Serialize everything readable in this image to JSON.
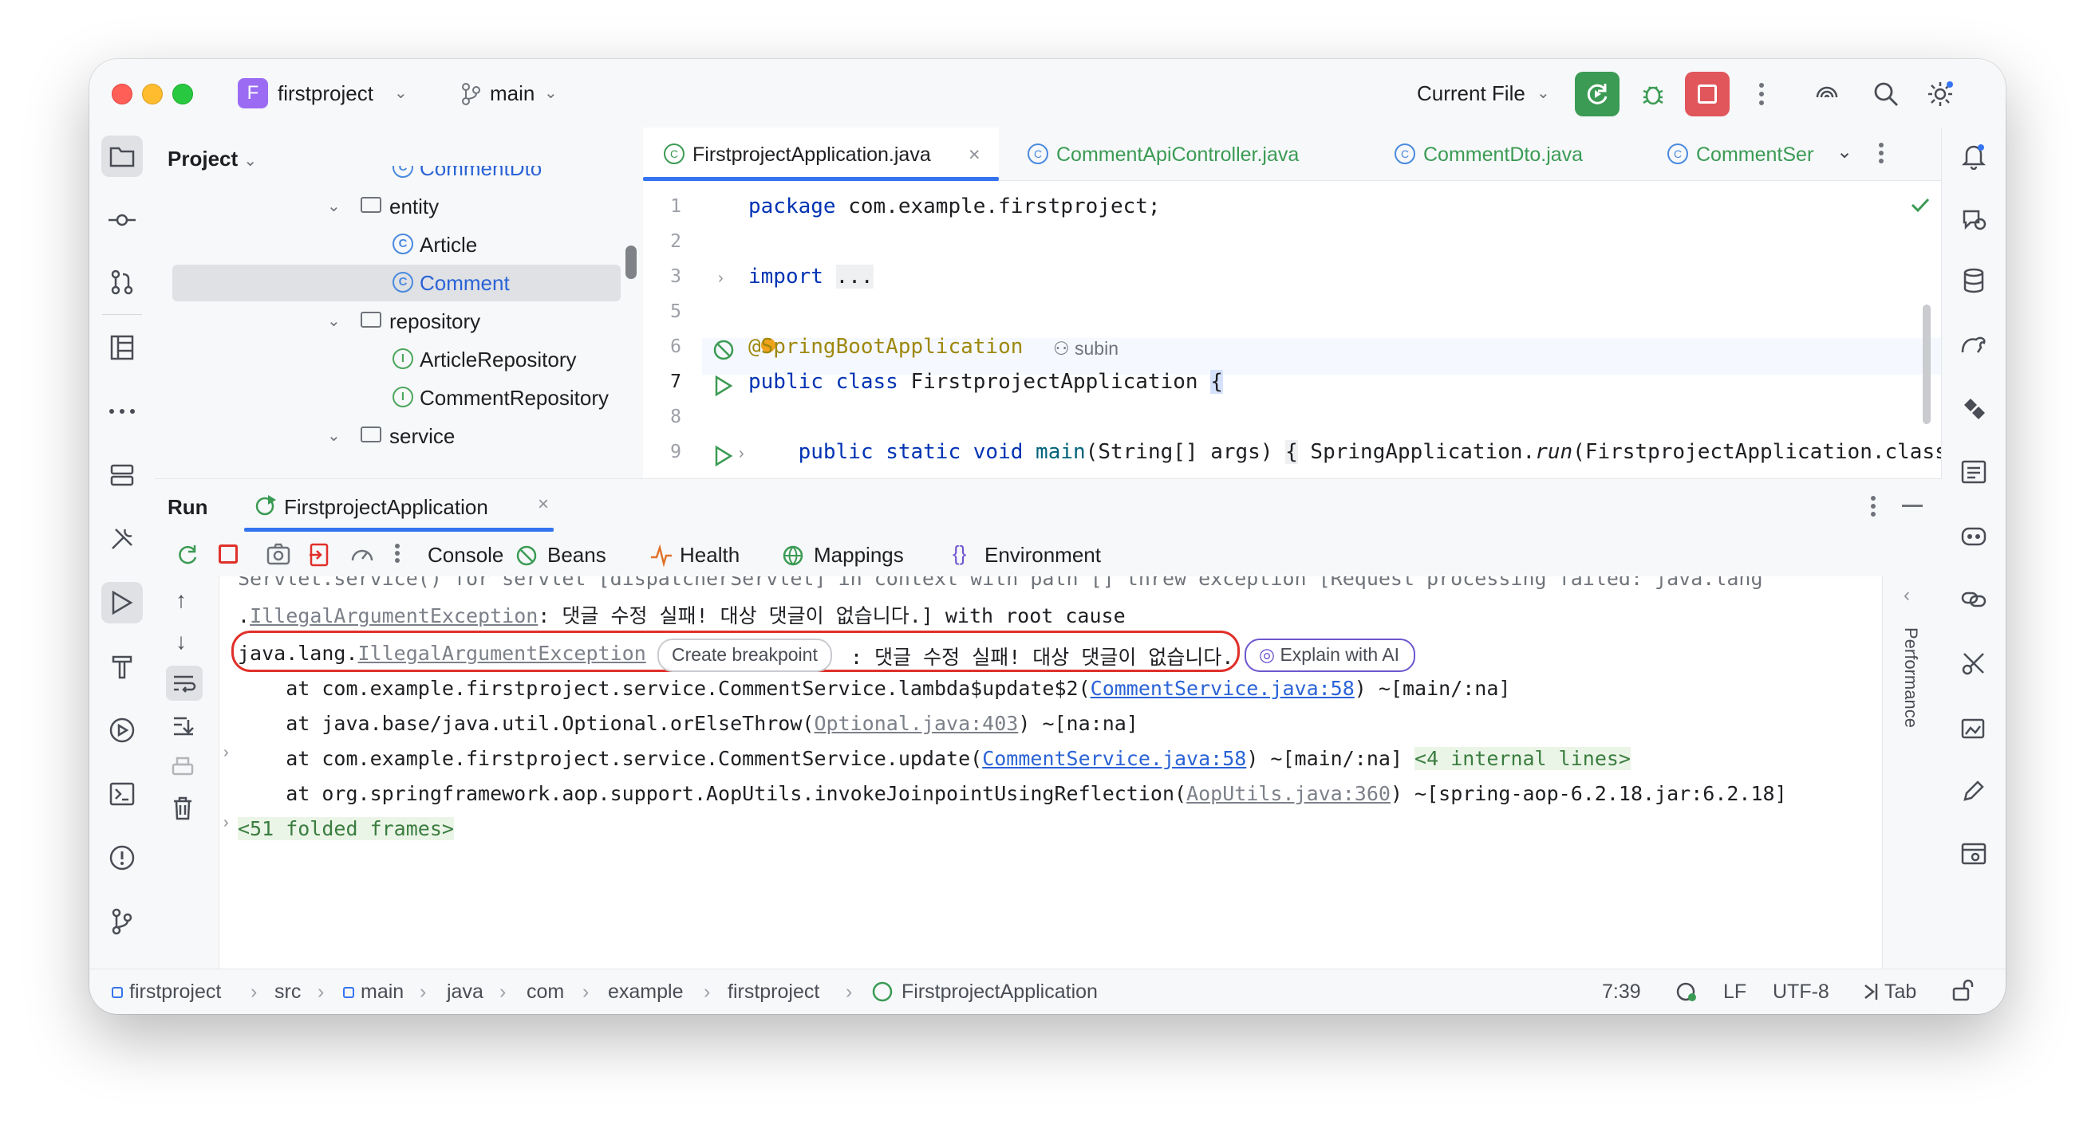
{
  "titlebar": {
    "project_badge": "F",
    "project_name": "firstproject",
    "branch": "main",
    "run_config": "Current File"
  },
  "project_panel": {
    "title": "Project",
    "items": [
      {
        "label": "CommentDto",
        "type": "class"
      },
      {
        "label": "entity",
        "type": "folder"
      },
      {
        "label": "Article",
        "type": "class"
      },
      {
        "label": "Comment",
        "type": "class",
        "selected": true
      },
      {
        "label": "repository",
        "type": "folder"
      },
      {
        "label": "ArticleRepository",
        "type": "interface",
        "icon_letter": "I"
      },
      {
        "label": "CommentRepository",
        "type": "interface",
        "icon_letter": "I"
      },
      {
        "label": "service",
        "type": "folder"
      }
    ],
    "class_icon_letter": "C"
  },
  "editor": {
    "tabs": [
      {
        "label": "FirstprojectApplication.java",
        "active": true
      },
      {
        "label": "CommentApiController.java"
      },
      {
        "label": "CommentDto.java"
      },
      {
        "label": "CommentServ"
      }
    ],
    "line_numbers": [
      "1",
      "2",
      "3",
      "5",
      "6",
      "7",
      "8",
      "9"
    ],
    "code": {
      "l1_kw": "package",
      "l1_rest": " com.example.firstproject;",
      "l3_kw": "import",
      "l3_fold": "...",
      "l6_ann": "@SpringBootApplication",
      "l6_author": "subin",
      "l7_kw": "public class",
      "l7_rest": " FirstprojectApplication ",
      "l7_brace": "{",
      "l9_kw": "public static void",
      "l9_fn": "main",
      "l9_args": "(String[] args) ",
      "l9_brace": "{",
      "l9_call": " SpringApplication.",
      "l9_run": "run",
      "l9_tail": "(FirstprojectApplication.class"
    }
  },
  "run_panel": {
    "title": "Run",
    "config_tab": "FirstprojectApplication",
    "tabs": [
      "Console",
      "Beans",
      "Health",
      "Mappings",
      "Environment"
    ],
    "console": {
      "line0": "Servlet.service() for servlet [dispatcherServlet] in context with path [] threw exception [Request processing failed: java.lang",
      "line1_pre": ".",
      "line1_link": "IllegalArgumentException",
      "line1_rest": ": 댓글 수정 실패! 대상 댓글이 없습니다.] with root cause",
      "exc_prefix": "java.lang.",
      "exc_link": "IllegalArgumentException",
      "create_breakpoint": "Create breakpoint",
      "exc_msg": ": 댓글 수정 실패! 대상 댓글이 없습니다.",
      "explain_ai": "Explain with AI",
      "at1_pre": "    at com.example.firstproject.service.CommentService.lambda$update$2(",
      "at1_link": "CommentService.java:58",
      "at1_post": ") ~[main/:na]",
      "at2_pre": "    at java.base/java.util.Optional.orElseThrow(",
      "at2_link": "Optional.java:403",
      "at2_post": ") ~[na:na]",
      "at3_pre": "    at com.example.firstproject.service.CommentService.update(",
      "at3_link": "CommentService.java:58",
      "at3_post": ") ~[main/:na] ",
      "at3_internal": "<4 internal lines>",
      "at4_pre": "    at org.springframework.aop.support.AopUtils.invokeJoinpointUsingReflection(",
      "at4_link": "AopUtils.java:360",
      "at4_post": ") ~[spring-aop-6.2.18.jar:6.2.18]",
      "folded": "<51 folded frames>"
    },
    "performance_label": "Performance"
  },
  "statusbar": {
    "breadcrumbs": [
      "firstproject",
      "src",
      "main",
      "java",
      "com",
      "example",
      "firstproject",
      "FirstprojectApplication"
    ],
    "position": "7:39",
    "line_sep": "LF",
    "encoding": "UTF-8",
    "indent": "Tab"
  },
  "colors": {
    "accent": "#3574f0",
    "run_green": "#3b9b54",
    "stop_red": "#e0565b",
    "highlight_red": "#e0302a",
    "ai_purple": "#6e56cf"
  }
}
